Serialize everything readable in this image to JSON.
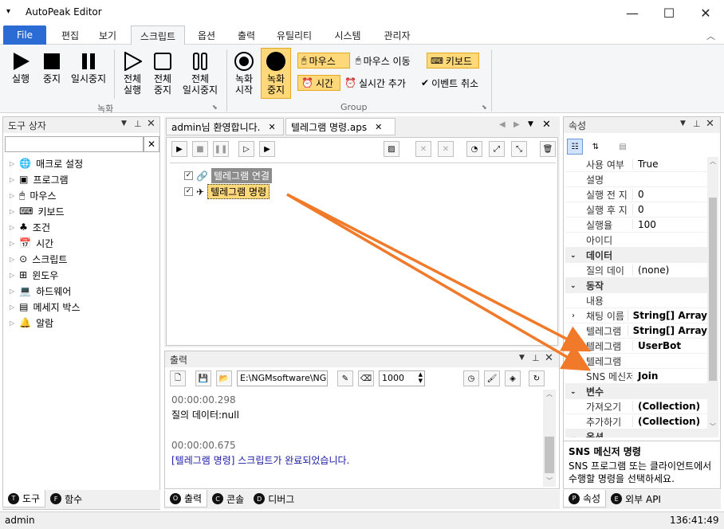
{
  "window": {
    "title": "AutoPeak Editor"
  },
  "ribbon_tabs": [
    "File",
    "편집",
    "보기",
    "스크립트",
    "옵션",
    "출력",
    "유틸리티",
    "시스템",
    "관리자"
  ],
  "ribbon": {
    "run": "실행",
    "stop": "중지",
    "pause": "일시중지",
    "run_all": [
      "전체",
      "실행"
    ],
    "stop_all": [
      "전체",
      "중지"
    ],
    "pause_all": [
      "전체",
      "일시중지"
    ],
    "rec_start": [
      "녹화",
      "시작"
    ],
    "rec_stop": [
      "녹화",
      "중지"
    ],
    "mouse_chip": "마우스",
    "mouse_move": "마우스 이동",
    "keyboard": "키보드",
    "time": "시간",
    "realtime_add": "실시간 추가",
    "event_cancel": "이벤트 취소",
    "group_record": "녹화",
    "group_group": "Group"
  },
  "toolbox": {
    "title": "도구 상자",
    "items": [
      "매크로 설정",
      "프로그램",
      "마우스",
      "키보드",
      "조건",
      "시간",
      "스크립트",
      "윈도우",
      "하드웨어",
      "메세지 박스",
      "알람"
    ],
    "tabs": [
      "도구",
      "함수"
    ]
  },
  "doc_tabs": [
    "admin님 환영합니다.",
    "텔레그램 명령.aps"
  ],
  "script_tree": [
    "텔레그램 연결",
    "텔레그램 명령"
  ],
  "output": {
    "title": "출력",
    "path": "E:\\NGMsoftware\\NG",
    "delay": "1000",
    "lines": [
      "00:00:00.298",
      "질의 데이터:null",
      "",
      "00:00:00.675",
      "[텔레그램 명령] 스크립트가 완료되었습니다."
    ],
    "tabs": [
      "출력",
      "콘솔",
      "디버그"
    ]
  },
  "properties": {
    "title": "속성",
    "rows": [
      {
        "k": "사용 여부",
        "v": "True"
      },
      {
        "k": "설명",
        "v": ""
      },
      {
        "k": "실행 전 지",
        "v": "0"
      },
      {
        "k": "실행 후 지",
        "v": "0"
      },
      {
        "k": "실행율",
        "v": "100"
      },
      {
        "k": "아이디",
        "v": ""
      },
      {
        "cat": "데이터"
      },
      {
        "k": "질의 데이",
        "v": "(none)"
      },
      {
        "cat": "동작"
      },
      {
        "k": "내용",
        "v": ""
      },
      {
        "k": "채팅 이름",
        "v": "String[] Array",
        "b": true,
        "exp": true
      },
      {
        "k": "텔레그램",
        "v": "String[] Array",
        "b": true,
        "exp": true
      },
      {
        "k": "텔레그램",
        "v": "UserBot",
        "b": true
      },
      {
        "k": "텔레그램",
        "v": ""
      },
      {
        "k": "SNS 메신저",
        "v": "Join",
        "b": true
      },
      {
        "cat": "변수"
      },
      {
        "k": "가져오기",
        "v": "(Collection)",
        "b": true
      },
      {
        "k": "추가하기",
        "v": "(Collection)",
        "b": true
      },
      {
        "cat": "옵션"
      }
    ],
    "desc_title": "SNS 메신저 명령",
    "desc_text": "SNS 프로그램 또는 클라이언트에서 수행할 명령을 선택하세요.",
    "tabs": [
      "속성",
      "외부 API"
    ]
  },
  "status": {
    "user": "admin",
    "time": "136:41:49"
  },
  "colors": {
    "accent": "#2b6cd4",
    "arrow": "#f07a2a",
    "highlight": "#ffd87a"
  }
}
